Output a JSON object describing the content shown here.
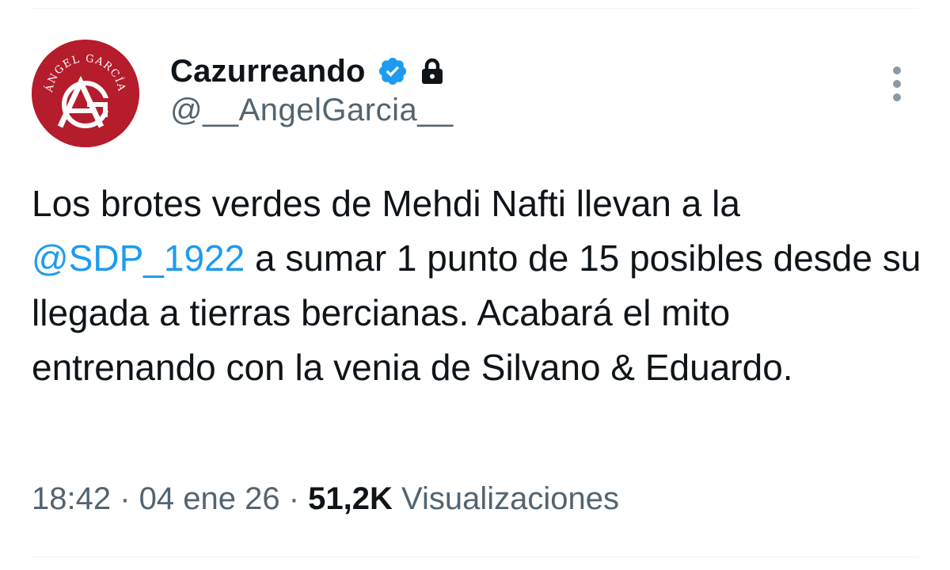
{
  "author": {
    "avatar_alt": "ÁNGEL GARCÍA",
    "avatar_monogram": "AG",
    "display_name": "Cazurreando",
    "handle": "@__AngelGarcia__",
    "verified": true,
    "protected": true
  },
  "tweet": {
    "text_before_mention": "Los brotes verdes de Mehdi Nafti llevan a la ",
    "mention": "@SDP_1922",
    "text_after_mention": " a sumar 1 punto de 15 posibles desde su llegada a tierras bercianas. Acabará el mito entrenando con la venia de Silvano & Eduardo."
  },
  "meta": {
    "time": "18:42",
    "separator": " · ",
    "date": "04 ene 26",
    "views_count": "51,2K",
    "views_label": "Visualizaciones"
  },
  "icons": {
    "verified": "verified-badge-icon",
    "lock": "lock-icon",
    "more": "more-vertical-icon"
  },
  "colors": {
    "accent": "#1d9bf0",
    "avatar_bg": "#b51c2c",
    "secondary_text": "#536471",
    "primary_text": "#0f1419"
  }
}
